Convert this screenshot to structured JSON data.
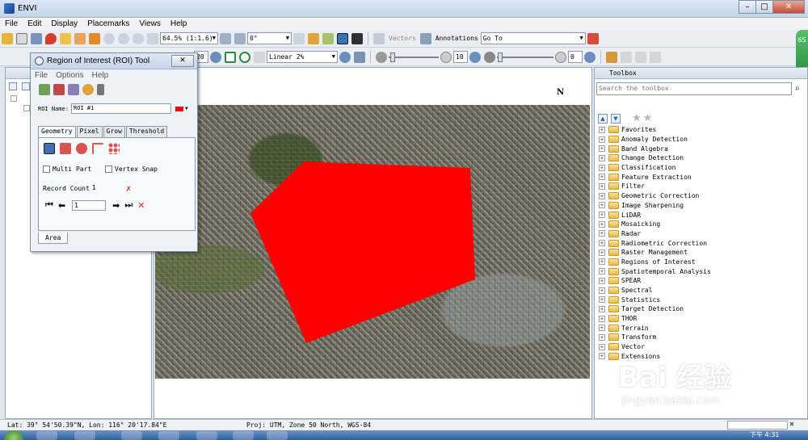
{
  "window": {
    "title": "ENVI"
  },
  "menu": [
    "File",
    "Edit",
    "Display",
    "Placemarks",
    "Views",
    "Help"
  ],
  "toolbar1": {
    "zoom_value": "64.5% (1:1.6)",
    "rotation_value": "0°",
    "vectors_label": "Vectors",
    "annotations_label": "Annotations",
    "goto_value": "Go To"
  },
  "toolbar2": {
    "stretch_value": "Linear 2%",
    "brightness_value": "20",
    "sharpen_value": "10",
    "transparency_value": "0"
  },
  "roi_tool": {
    "title": "Region of Interest (ROI) Tool",
    "menu": [
      "File",
      "Options",
      "Help"
    ],
    "roi_name_label": "ROI Name:",
    "roi_name_value": "ROI #1",
    "roi_color": "#ff0000",
    "tabs": [
      "Geometry",
      "Pixel",
      "Grow",
      "Threshold"
    ],
    "active_tab": "Geometry",
    "multi_part_label": "Multi Part",
    "vertex_snap_label": "Vertex Snap",
    "record_count_label": "Record Count",
    "record_count_value": "1",
    "record_index_value": "1",
    "bottom_tab": "Area"
  },
  "toolbox": {
    "title": "Toolbox",
    "search_placeholder": "Search the toolbox",
    "items": [
      "Favorites",
      "Anomaly Detection",
      "Band Algebra",
      "Change Detection",
      "Classification",
      "Feature Extraction",
      "Filter",
      "Geometric Correction",
      "Image Sharpening",
      "LiDAR",
      "Mosaicking",
      "Radar",
      "Radiometric Correction",
      "Raster Management",
      "Regions of Interest",
      "Spatiotemporal Analysis",
      "SPEAR",
      "Spectral",
      "Statistics",
      "Target Detection",
      "THOR",
      "Terrain",
      "Transform",
      "Vector",
      "Extensions"
    ]
  },
  "map": {
    "north_label": "N",
    "roi_fill_color": "#ff0000"
  },
  "status": {
    "coords": "Lat: 39° 54'50.39\"N, Lon: 116° 20'17.84\"E",
    "projection": "Proj: UTM, Zone 50 North, WGS-84"
  },
  "taskbar": {
    "clock": "下午 4:31"
  },
  "watermark": {
    "text": "Bai 经验",
    "url": "jingyan.baidu.com"
  }
}
